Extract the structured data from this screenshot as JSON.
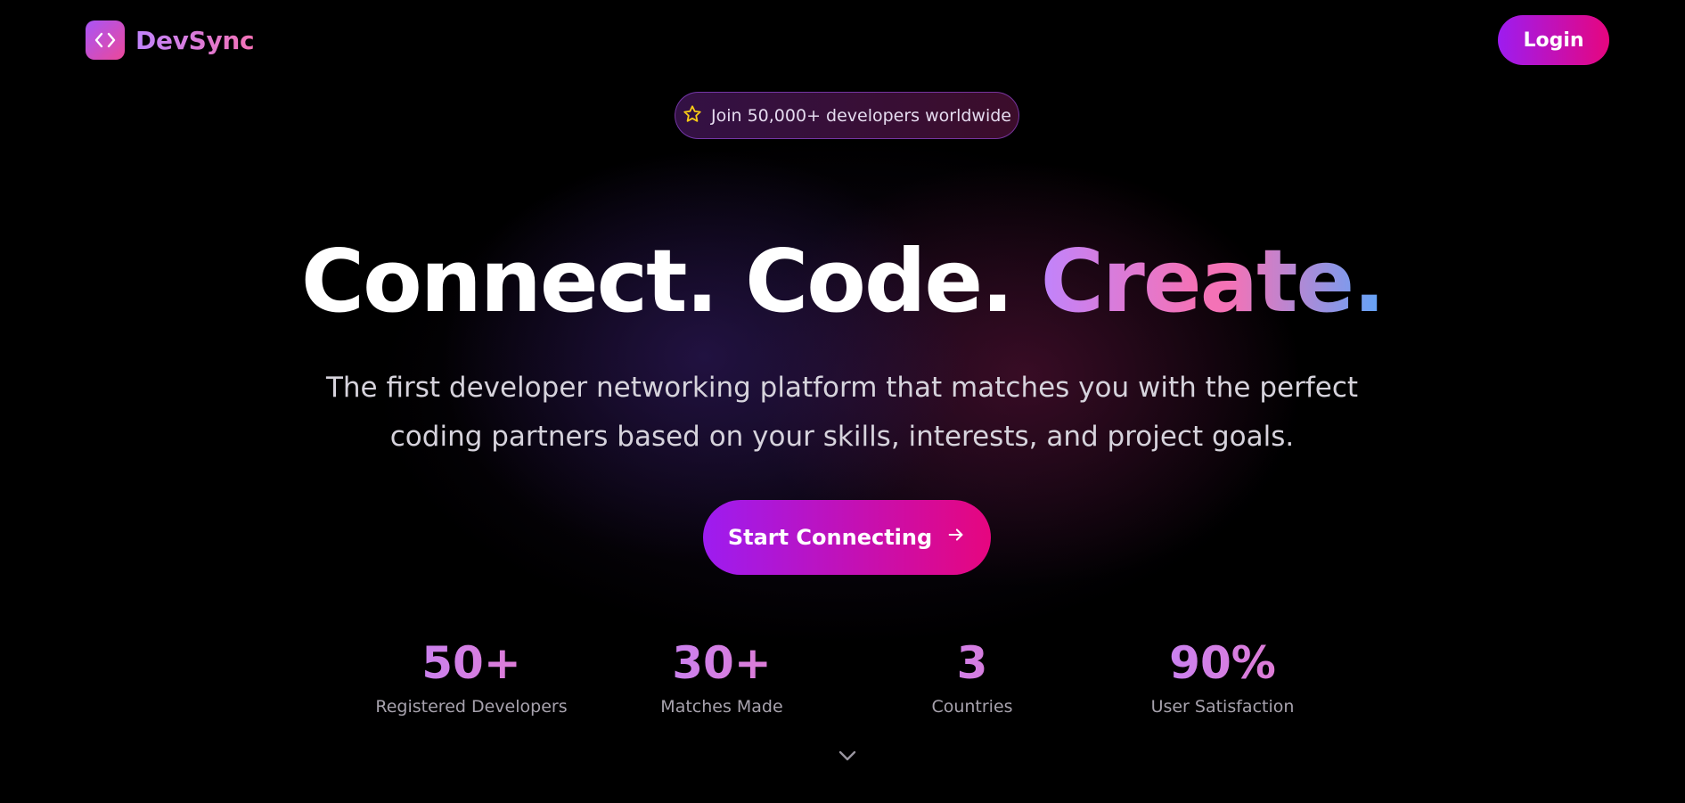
{
  "nav": {
    "brand": "DevSync",
    "logo_icon": "code-brackets-icon",
    "login_label": "Login"
  },
  "badge": {
    "icon": "star-icon",
    "text": "Join 50,000+ developers worldwide"
  },
  "hero": {
    "headline_part1": "Connect. Code. ",
    "headline_part2": "Create.",
    "subtitle": "The first developer networking platform that matches you with the perfect coding partners based on your skills, interests, and project goals.",
    "cta_label": "Start Connecting",
    "cta_icon": "arrow-right-icon"
  },
  "stats": [
    {
      "value": "50+",
      "label": "Registered Developers"
    },
    {
      "value": "30+",
      "label": "Matches Made"
    },
    {
      "value": "3",
      "label": "Countries"
    },
    {
      "value": "90%",
      "label": "User Satisfaction"
    }
  ],
  "scroll_icon": "chevron-down-icon",
  "colors": {
    "background": "#000000",
    "accent_purple": "#9d1cf0",
    "accent_pink": "#e6067f",
    "star_yellow": "#facc15"
  }
}
